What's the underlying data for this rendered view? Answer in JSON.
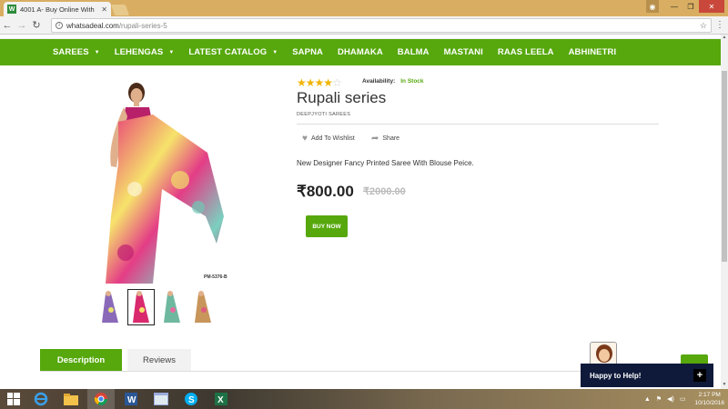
{
  "browser": {
    "tab_title": "4001 A- Buy Online With",
    "tab_favicon_letter": "W",
    "url_domain": "whatsadeal.com",
    "url_path": "/rupali-series-5"
  },
  "nav": {
    "items": [
      {
        "label": "SAREES",
        "dropdown": true
      },
      {
        "label": "LEHENGAS",
        "dropdown": true
      },
      {
        "label": "LATEST CATALOG",
        "dropdown": true
      },
      {
        "label": "SAPNA",
        "dropdown": false
      },
      {
        "label": "DHAMAKA",
        "dropdown": false
      },
      {
        "label": "BALMA",
        "dropdown": false
      },
      {
        "label": "MASTANI",
        "dropdown": false
      },
      {
        "label": "RAAS LEELA",
        "dropdown": false
      },
      {
        "label": "ABHINETRI",
        "dropdown": false
      }
    ]
  },
  "product": {
    "rating": 4,
    "rating_max": 5,
    "availability_label": "Availability:",
    "availability_value": "In Stock",
    "title": "Rupali series",
    "brand": "DEEPJYOTI SAREES",
    "wishlist_label": "Add To Wishlist",
    "share_label": "Share",
    "description": "New Designer Fancy Printed Saree With Blouse Peice.",
    "price": "₹800.00",
    "old_price": "₹2000.00",
    "buy_label": "BUY NOW",
    "image_sku": "PM-5376-B"
  },
  "tabs": {
    "description": "Description",
    "reviews": "Reviews"
  },
  "chat": {
    "label": "Happy to Help!"
  },
  "taskbar": {
    "time": "2:17 PM",
    "date": "10/10/2016"
  },
  "colors": {
    "brand_green": "#56a80c",
    "chat_navy": "#0f1a3a",
    "star": "#f0b400"
  }
}
